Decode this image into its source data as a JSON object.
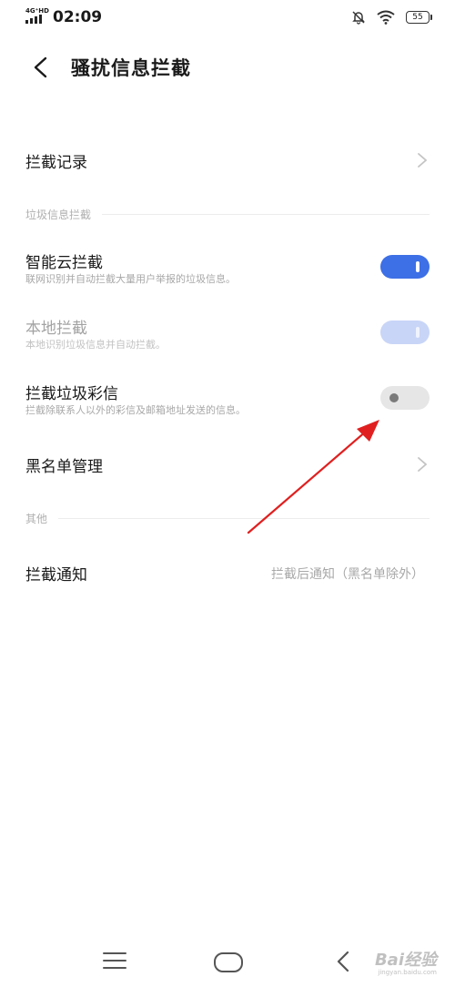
{
  "status_bar": {
    "network": "4G⁺HD",
    "time": "02:09",
    "battery": "55",
    "icons": [
      "signal-icon",
      "mute-bell-icon",
      "wifi-icon",
      "battery-icon"
    ]
  },
  "header": {
    "title": "骚扰信息拦截",
    "back_icon": "chevron-left-icon"
  },
  "rows": {
    "intercept_log": {
      "label": "拦截记录"
    },
    "spam_section": {
      "title": "垃圾信息拦截"
    },
    "smart_cloud": {
      "label": "智能云拦截",
      "sub": "联网识别并自动拦截大量用户举报的垃圾信息。",
      "state": "on"
    },
    "local": {
      "label": "本地拦截",
      "sub": "本地识别垃圾信息并自动拦截。",
      "state": "on-disabled"
    },
    "spam_mms": {
      "label": "拦截垃圾彩信",
      "sub": "拦截除联系人以外的彩信及邮箱地址发送的信息。",
      "state": "off"
    },
    "blacklist": {
      "label": "黑名单管理"
    },
    "other_section": {
      "title": "其他"
    },
    "notify": {
      "label": "拦截通知",
      "value": "拦截后通知（黑名单除外）"
    }
  },
  "navbar": {
    "icons": [
      "menu-icon",
      "home-icon",
      "back-icon"
    ],
    "watermark": "Bai经验",
    "watermark_sub": "jingyan.baidu.com"
  },
  "colors": {
    "accent": "#3d6fe6",
    "accent_disabled": "#c8d5f7",
    "toggle_off": "#e6e6e6",
    "annotation_arrow": "#e02020"
  }
}
